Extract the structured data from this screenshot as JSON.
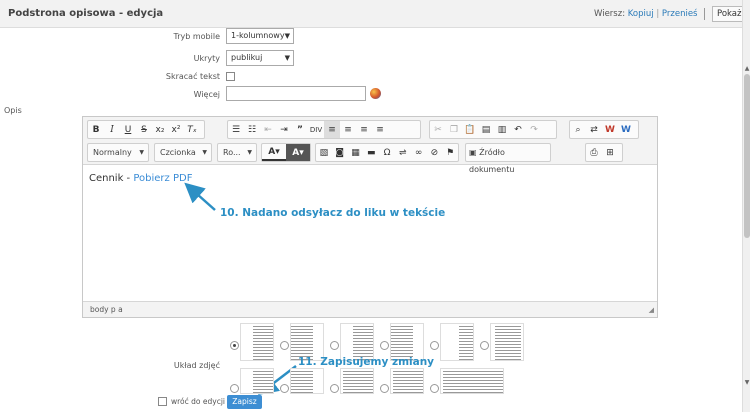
{
  "header": {
    "title": "Podstrona opisowa - edycja",
    "wiersz": "Wiersz:",
    "kopiuj": "Kopiuj",
    "sep": "|",
    "przenies": "Przenieś",
    "pokaz": "Pokaż"
  },
  "form": {
    "tryb_label": "Tryb mobile",
    "tryb_value": "1-kolumnowy",
    "ukryty_label": "Ukryty",
    "ukryty_value": "publikuj",
    "skracac_label": "Skracać tekst",
    "wiecej_label": "Więcej",
    "opis_label": "Opis",
    "uklad_label": "Układ zdjęć",
    "wroc_label": "wróć do edycji",
    "zapisz": "Zapisz"
  },
  "toolbar": {
    "format": "Normalny",
    "font": "Czcionka",
    "size": "Ro...",
    "source": "Źródło dokumentu"
  },
  "editor": {
    "text": "Cennik - ",
    "link": "Pobierz PDF",
    "path": "body  p  a"
  },
  "annotations": {
    "a1": "10. Nadano odsyłacz do liku w tekście",
    "a2": "11. Zapisujemy zmiany"
  },
  "colors": {
    "accent": "#2c8fc4",
    "link": "#3a8cd6",
    "button": "#3d8ed3"
  }
}
